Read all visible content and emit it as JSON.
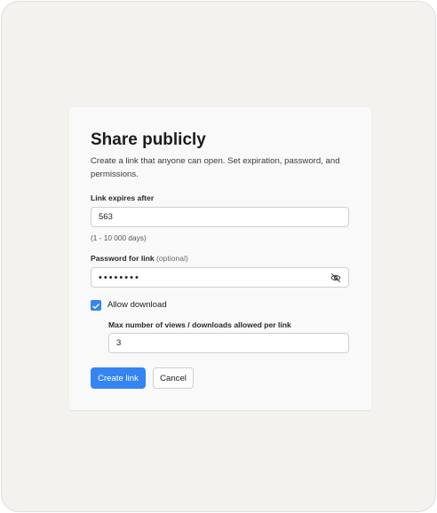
{
  "dialog": {
    "title": "Share publicly",
    "description": "Create a link that anyone can open. Set expiration, password, and permissions.",
    "expires": {
      "label": "Link expires after",
      "value": "563",
      "hint": "(1 - 10 000 days)"
    },
    "password": {
      "label": "Password for link",
      "optional": "(optional)",
      "masked_value": "••••••••",
      "toggle_icon": "eye-off-icon"
    },
    "allow_download": {
      "label": "Allow download",
      "checked": true
    },
    "max_views": {
      "label": "Max number of views / downloads allowed per link",
      "value": "3"
    },
    "buttons": {
      "create": "Create link",
      "cancel": "Cancel"
    }
  },
  "colors": {
    "accent": "#3484f3",
    "page_background": "#f3f2ee",
    "dialog_background": "#f9f9f9"
  }
}
